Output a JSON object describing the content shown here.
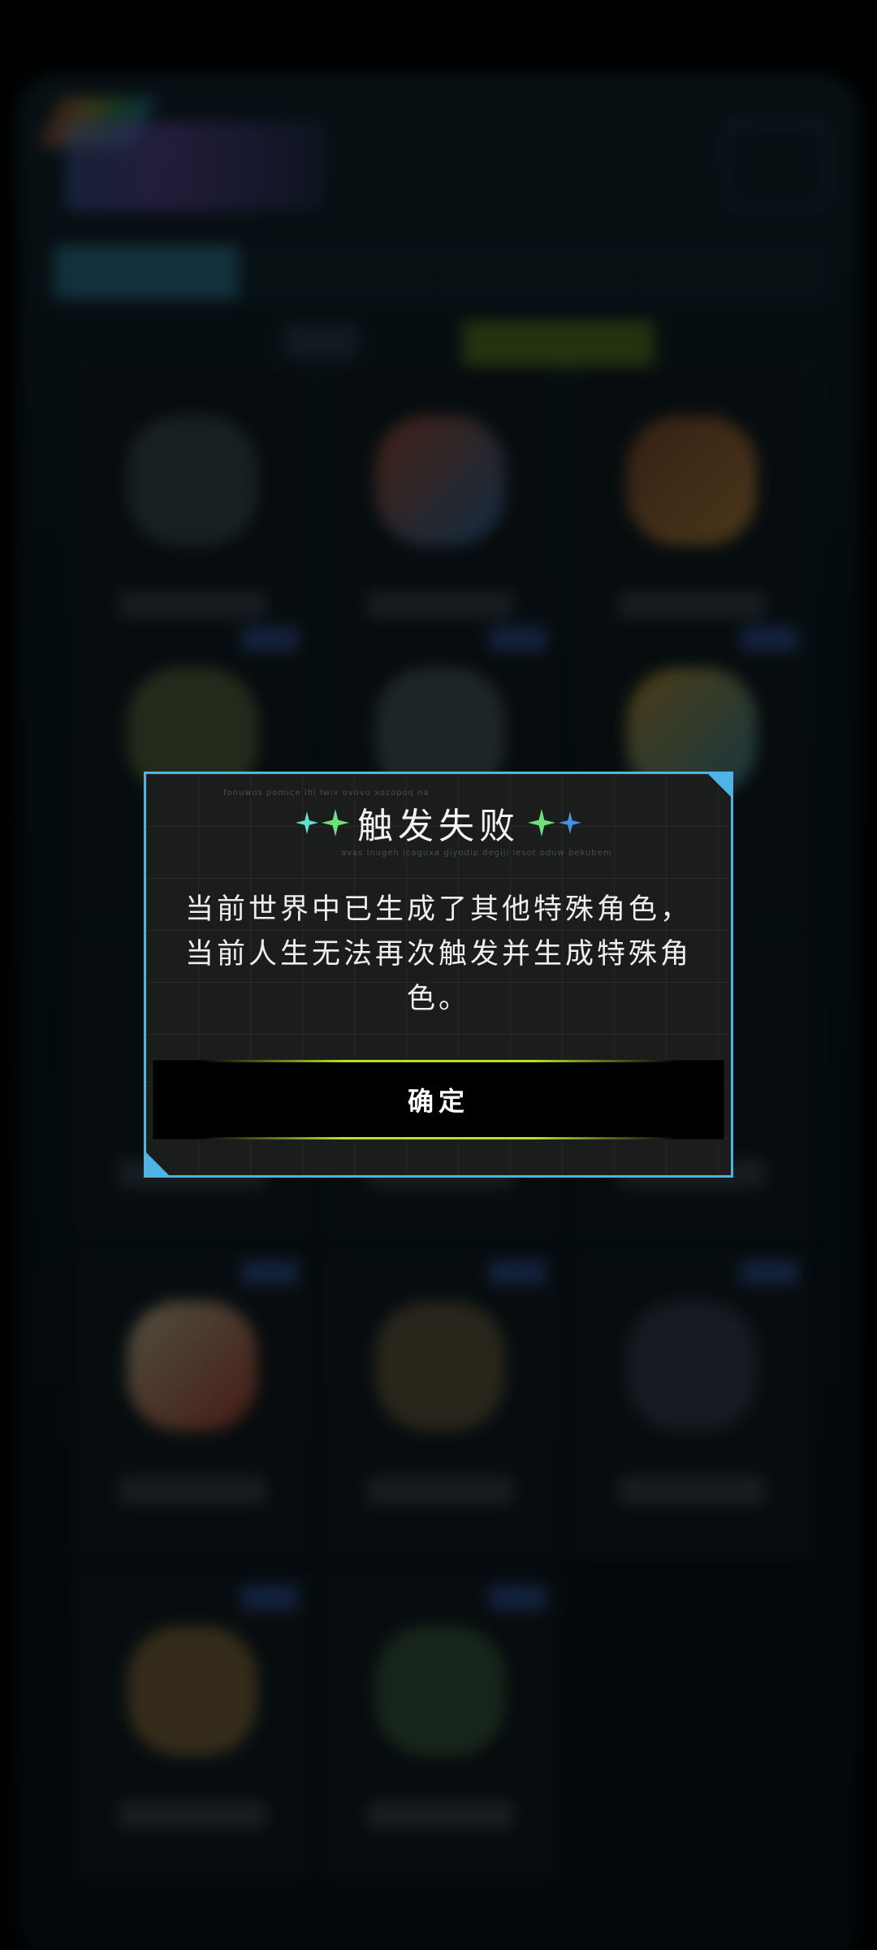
{
  "dialog": {
    "title": "触发失败",
    "message": "当前世界中已生成了其他特殊角色，当前人生无法再次触发并生成特殊角色。",
    "confirm_label": "确定",
    "decor_text_1": "fonuwos pomice ihi lwiv ovovo xozopoq na",
    "decor_text_2": "avas lnugeh icaguxa giyodip degiji lesot oduw bekubem",
    "border_color": "#4fb3e6",
    "accent_color": "#b6e22c"
  },
  "icons": {
    "title_star_1": "cyan-sparkle-icon",
    "title_star_2": "green-sparkle-icon",
    "title_star_3": "green-sparkle-icon",
    "title_star_4": "blue-sparkle-icon"
  }
}
